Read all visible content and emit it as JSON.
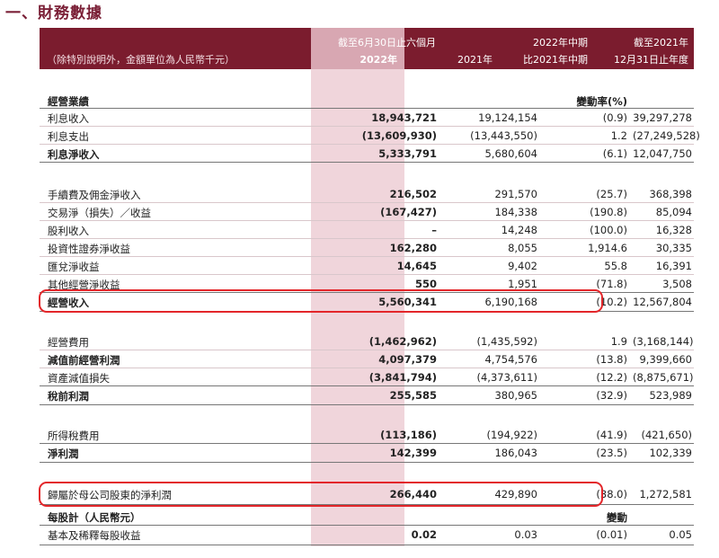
{
  "page_title": "一、財務數據",
  "header": {
    "note": "（除特別說明外，金額單位為人民幣千元）",
    "period_label": "截至6月30日止六個月",
    "col1": "2022年",
    "col2": "2021年",
    "change_line1": "2022年中期",
    "change_line2": "比2021年中期",
    "col4_line1": "截至2021年",
    "col4_line2": "12月31日止年度"
  },
  "section1": {
    "label": "經營業績",
    "change_header": "變動率(%)",
    "rows": [
      {
        "label": "利息收入",
        "v2022": "18,943,721",
        "v2021": "19,124,154",
        "chg": "(0.9)",
        "v2021y": "39,297,278"
      },
      {
        "label": "利息支出",
        "v2022": "(13,609,930)",
        "v2021": "(13,443,550)",
        "chg": "1.2",
        "v2021y": "(27,249,528)"
      },
      {
        "label": "利息淨收入",
        "v2022": "5,333,791",
        "v2021": "5,680,604",
        "chg": "(6.1)",
        "v2021y": "12,047,750"
      }
    ]
  },
  "section2": {
    "rows": [
      {
        "label": "手續費及佣金淨收入",
        "v2022": "216,502",
        "v2021": "291,570",
        "chg": "(25.7)",
        "v2021y": "368,398"
      },
      {
        "label": "交易淨（損失）／收益",
        "v2022": "(167,427)",
        "v2021": "184,338",
        "chg": "(190.8)",
        "v2021y": "85,094"
      },
      {
        "label": "股利收入",
        "v2022": "–",
        "v2021": "14,248",
        "chg": "(100.0)",
        "v2021y": "16,328"
      },
      {
        "label": "投資性證券淨收益",
        "v2022": "162,280",
        "v2021": "8,055",
        "chg": "1,914.6",
        "v2021y": "30,335"
      },
      {
        "label": "匯兌淨收益",
        "v2022": "14,645",
        "v2021": "9,402",
        "chg": "55.8",
        "v2021y": "16,391"
      },
      {
        "label": "其他經營淨收益",
        "v2022": "550",
        "v2021": "1,951",
        "chg": "(71.8)",
        "v2021y": "3,508"
      },
      {
        "label": "經營收入",
        "v2022": "5,560,341",
        "v2021": "6,190,168",
        "chg": "(10.2)",
        "v2021y": "12,567,804"
      }
    ]
  },
  "section3": {
    "rows": [
      {
        "label": "經營費用",
        "v2022": "(1,462,962)",
        "v2021": "(1,435,592)",
        "chg": "1.9",
        "v2021y": "(3,168,144)"
      },
      {
        "label": "減值前經營利潤",
        "v2022": "4,097,379",
        "v2021": "4,754,576",
        "chg": "(13.8)",
        "v2021y": "9,399,660"
      },
      {
        "label": "資產減值損失",
        "v2022": "(3,841,794)",
        "v2021": "(4,373,611)",
        "chg": "(12.2)",
        "v2021y": "(8,875,671)"
      },
      {
        "label": "稅前利潤",
        "v2022": "255,585",
        "v2021": "380,965",
        "chg": "(32.9)",
        "v2021y": "523,989"
      }
    ]
  },
  "section4": {
    "rows": [
      {
        "label": "所得稅費用",
        "v2022": "(113,186)",
        "v2021": "(194,922)",
        "chg": "(41.9)",
        "v2021y": "(421,650)"
      },
      {
        "label": "淨利潤",
        "v2022": "142,399",
        "v2021": "186,043",
        "chg": "(23.5)",
        "v2021y": "102,339"
      }
    ]
  },
  "section5": {
    "rows": [
      {
        "label": "歸屬於母公司股東的淨利潤",
        "v2022": "266,440",
        "v2021": "429,890",
        "chg": "(38.0)",
        "v2021y": "1,272,581"
      }
    ],
    "eps_label": "每股計（人民幣元）",
    "eps_change_header": "變動",
    "eps_rows": [
      {
        "label": "基本及稀釋每股收益",
        "v2022": "0.02",
        "v2021": "0.03",
        "chg": "(0.01)",
        "v2021y": "0.05"
      }
    ]
  },
  "colors": {
    "header_bg": "#7b1c2e",
    "highlight_col": "#f0d5db",
    "title": "#7a1f36",
    "annotation_box": "#e3262a"
  }
}
